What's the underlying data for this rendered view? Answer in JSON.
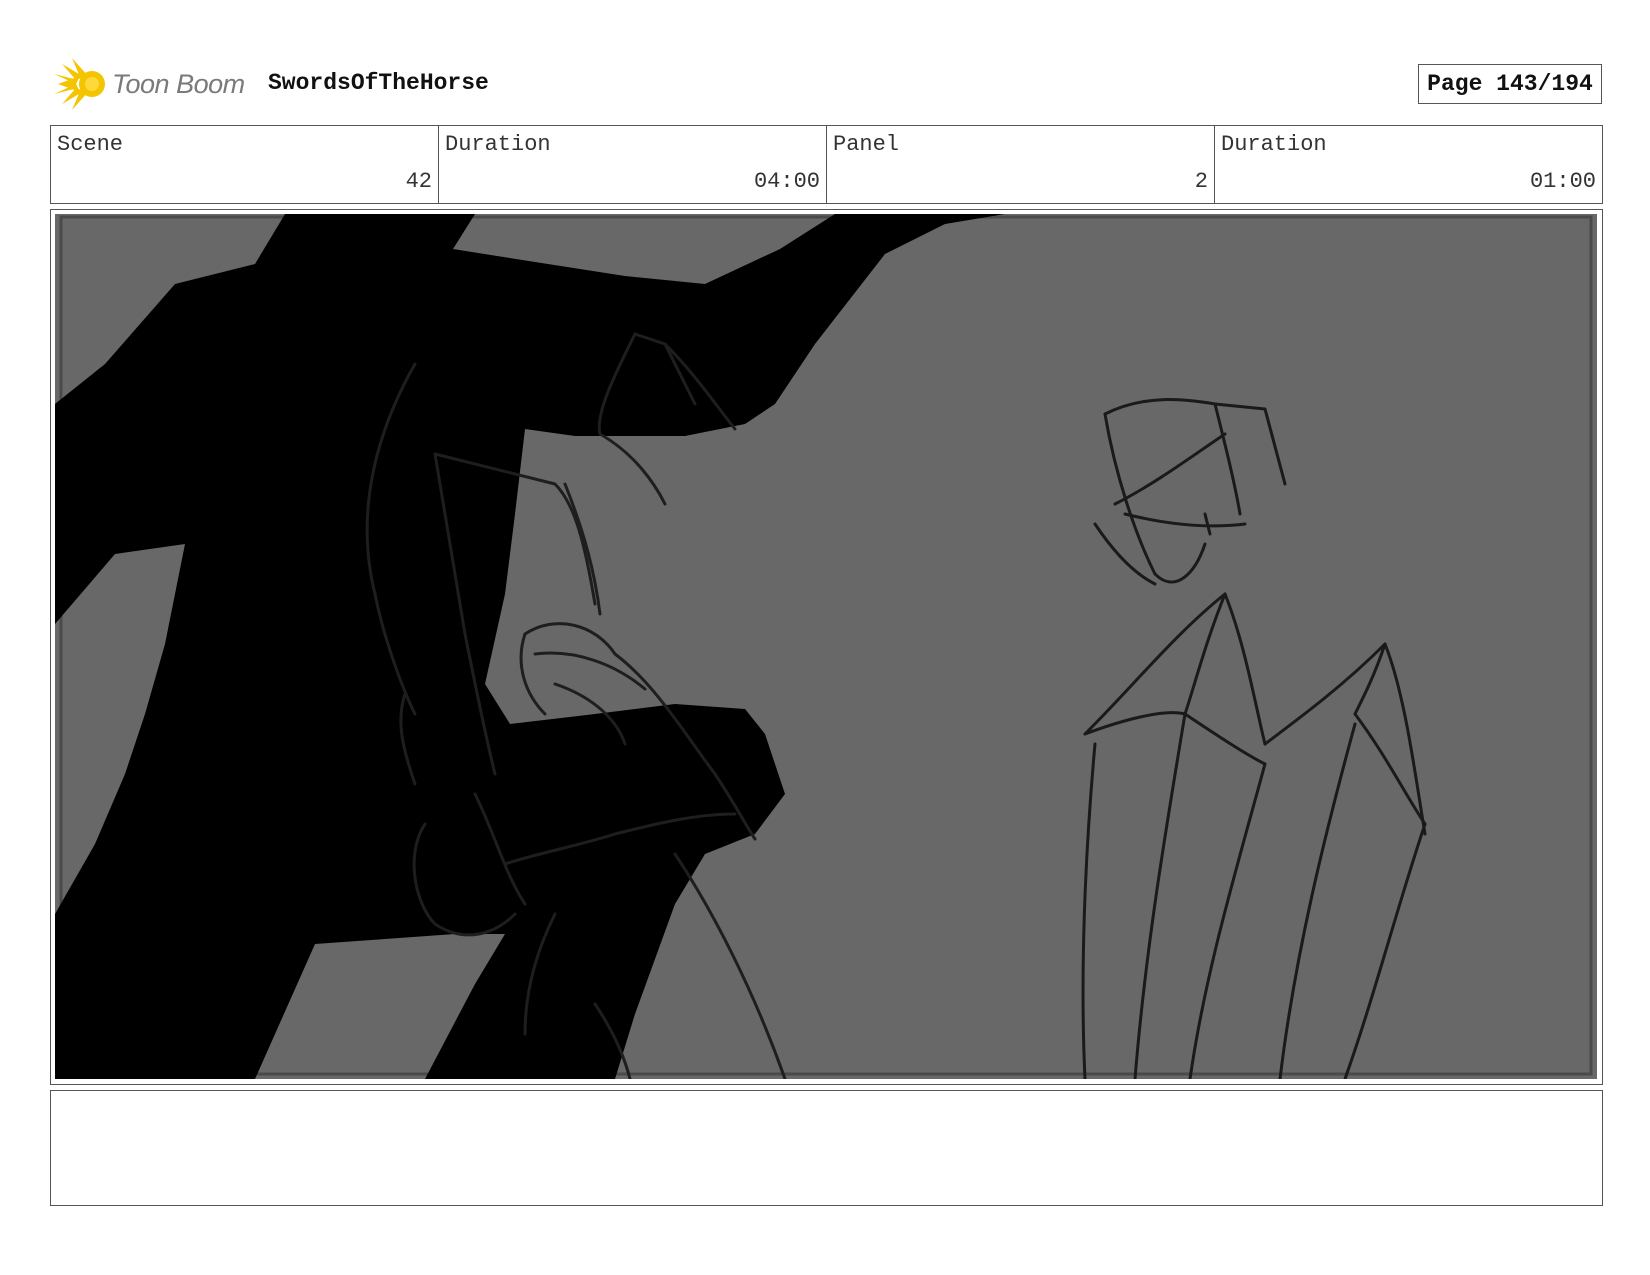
{
  "header": {
    "logo_text": "Toon Boom",
    "project_title": "SwordsOfTheHorse",
    "page_label": "Page 143/194"
  },
  "info": {
    "scene_label": "Scene",
    "scene_value": "42",
    "scene_duration_label": "Duration",
    "scene_duration_value": "04:00",
    "panel_label": "Panel",
    "panel_value": "2",
    "panel_duration_label": "Duration",
    "panel_duration_value": "01:00"
  },
  "notes": {
    "text": ""
  },
  "colors": {
    "background": "#686868",
    "silhouette": "#000000",
    "sketch_lines": "#1e1e1e",
    "logo_yellow": "#f5c400",
    "logo_text": "#7a7a7a"
  },
  "icons": {
    "logo": "toon-boom-star-icon"
  }
}
